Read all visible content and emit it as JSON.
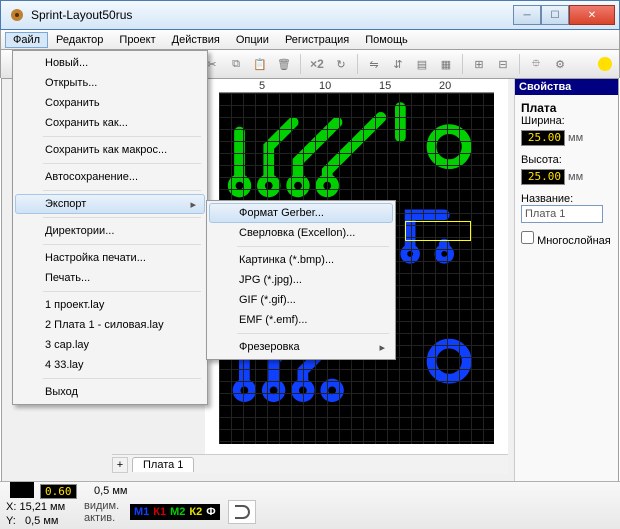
{
  "window": {
    "title": "Sprint-Layout50rus"
  },
  "menubar": [
    "Файл",
    "Редактор",
    "Проект",
    "Действия",
    "Опции",
    "Регистрация",
    "Помощь"
  ],
  "toolbar": {
    "x2": "×2"
  },
  "ruler": {
    "t5": "5",
    "t10": "10",
    "t15": "15",
    "t20": "20"
  },
  "props": {
    "header": "Свойства",
    "board": "Плата",
    "width_lbl": "Ширина:",
    "width_val": "25.00",
    "height_lbl": "Высота:",
    "height_val": "25.00",
    "unit": "мм",
    "name_lbl": "Название:",
    "name_val": "Плата 1",
    "multilayer": "Многослойная"
  },
  "filemenu": {
    "new": "Новый...",
    "open": "Открыть...",
    "save": "Сохранить",
    "saveas": "Сохранить как...",
    "savemacro": "Сохранить как макрос...",
    "autosave": "Автосохранение...",
    "export": "Экспорт",
    "dirs": "Директории...",
    "printsetup": "Настройка печати...",
    "print": "Печать...",
    "r1": "1 проект.lay",
    "r2": "2 Плата 1 - силовая.lay",
    "r3": "3 cap.lay",
    "r4": "4 33.lay",
    "exit": "Выход"
  },
  "expmenu": {
    "gerber": "Формат Gerber...",
    "drill": "Сверловка (Excellon)...",
    "bmp": "Картинка (*.bmp)...",
    "jpg": "JPG (*.jpg)...",
    "gif": "GIF (*.gif)...",
    "emf": "EMF (*.emf)...",
    "mill": "Фрезеровка"
  },
  "tabstrip": {
    "tab1": "Плата 1"
  },
  "lowbar": {
    "zoom": "0.60",
    "grid": "0,5 мм",
    "x_lbl": "X:",
    "x_val": "15,21 мм",
    "y_lbl": "Y:",
    "y_val": "0,5 мм",
    "vis": "видим.",
    "act": "актив."
  },
  "layers": {
    "m1": "М1",
    "k1": "К1",
    "m2": "М2",
    "k2": "К2",
    "f": "Ф"
  }
}
